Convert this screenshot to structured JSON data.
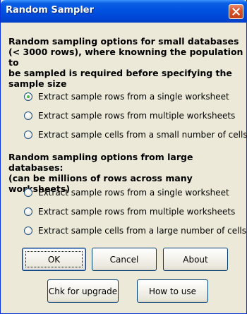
{
  "window": {
    "title": "Random Sampler"
  },
  "small_section": {
    "heading_lines": [
      "Random sampling options for small databases",
      "(< 3000 rows), where knowning the population to",
      "be sampled is required before specifying the",
      "sample size"
    ],
    "options": [
      {
        "label": "Extract sample rows from a single worksheet",
        "checked": true
      },
      {
        "label": "Extract sample rows from multiple worksheets",
        "checked": false
      },
      {
        "label": "Extract sample cells from a small number of cells",
        "checked": false
      }
    ]
  },
  "large_section": {
    "heading_lines": [
      "Random sampling options from large databases:",
      "(can be millions of rows across many worksheets)"
    ],
    "options": [
      {
        "label": "Extract sample rows from a single worksheet",
        "checked": false
      },
      {
        "label": "Extract sample rows from multiple worksheets",
        "checked": false
      },
      {
        "label": "Extract sample cells from a large number of cells",
        "checked": false
      }
    ]
  },
  "buttons": {
    "ok": "OK",
    "cancel": "Cancel",
    "about": "About",
    "upgrade": "Chk for upgrade",
    "how_to_use": "How to use"
  },
  "colors": {
    "titlebar": "#0054e3",
    "dialog_bg": "#ece9d8",
    "close_button": "#d9522d",
    "radio_dot": "#21a121"
  }
}
